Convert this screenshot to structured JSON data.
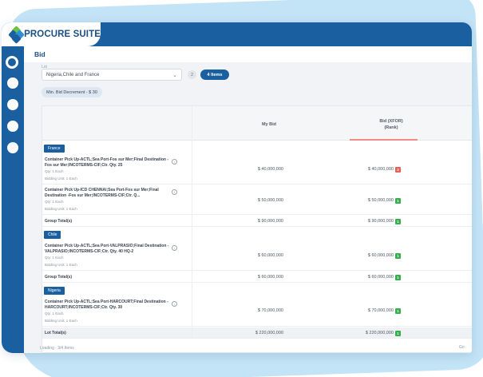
{
  "app": {
    "brand": "PROCURE SUITE"
  },
  "page": {
    "title": "Bid"
  },
  "colors": {
    "primary": "#1a5f9f",
    "accent_green": "#36b04f",
    "accent_red": "#e4615a",
    "background_blob": "#c3e4f6"
  },
  "sidebar": {
    "items": [
      {
        "icon": "home-icon",
        "active": true
      },
      {
        "icon": "menu-icon"
      },
      {
        "icon": "menu-icon"
      },
      {
        "icon": "menu-icon"
      },
      {
        "icon": "menu-icon"
      }
    ]
  },
  "filters": {
    "lot_label": "Lot",
    "lot_value": "Nigeria,Chile and France",
    "count": "2",
    "items_badge": "4 Items",
    "decrement_chip": "Min. Bid Decrement - $ 30"
  },
  "table": {
    "columns": {
      "my_bid": "My Bid",
      "bid_line1": "Bid (XFOR)",
      "bid_line2": "(Rank)"
    },
    "groups": [
      {
        "name": "France",
        "items": [
          {
            "desc": "Container Pick Up-ACTL;Sea Port-Fos sur Mer;Final Destination -Fos sur Mer;INCOTERMS-CIF;Ctr. Qty. 25",
            "qty": "Qty: 1 Each",
            "unit": "Bidding Unit: 1 Each",
            "my_bid": "$ 40,000,000",
            "bid": "$ 40,000,000",
            "rank": "2",
            "rank_color": "red"
          },
          {
            "desc": "Container Pick Up-ICD CHENNAI;Sea Port-Fos sur Mer;Final Destination -Fos sur Mer;INCOTERMS-CIF;Ctr. Q...",
            "qty": "Qty: 1 Each",
            "unit": "Bidding Unit: 1 Each",
            "my_bid": "$ 50,000,000",
            "bid": "$ 50,000,000",
            "rank": "1",
            "rank_color": "green"
          }
        ],
        "total_label": "Group Total(s)",
        "total_my_bid": "$ 90,000,000",
        "total_bid": "$ 90,000,000",
        "total_rank": "1"
      },
      {
        "name": "Chile",
        "items": [
          {
            "desc": "Container Pick Up-ACTL;Sea Port-VALPRASIO;Final Destination -VALPRASIO;INCOTERMS-CIF;Ctr. Qty. 40 HQ-2",
            "qty": "Qty: 1 Each",
            "unit": "Bidding Unit: 1 Each",
            "my_bid": "$ 60,000,000",
            "bid": "$ 60,000,000",
            "rank": "1",
            "rank_color": "green"
          }
        ],
        "total_label": "Group Total(s)",
        "total_my_bid": "$ 60,000,000",
        "total_bid": "$ 60,000,000",
        "total_rank": "1"
      },
      {
        "name": "Nigeria",
        "items": [
          {
            "desc": "Container Pick Up-ACTL;Sea Port-HARCOURT;Final Destination -HARCOURT;INCOTERMS-CIF;Ctr. Qty. 30",
            "qty": "Qty: 1 Each",
            "unit": "Bidding Unit: 1 Each",
            "my_bid": "$ 70,000,000",
            "bid": "$ 70,000,000",
            "rank": "1",
            "rank_color": "green"
          }
        ]
      }
    ],
    "lot_total": {
      "label": "Lot Total(s)",
      "my_bid": "$ 220,000,000",
      "bid": "$ 220,000,000",
      "rank": "1"
    }
  },
  "footer": {
    "text": "Loading · 3/4 Items",
    "right": "Go"
  }
}
